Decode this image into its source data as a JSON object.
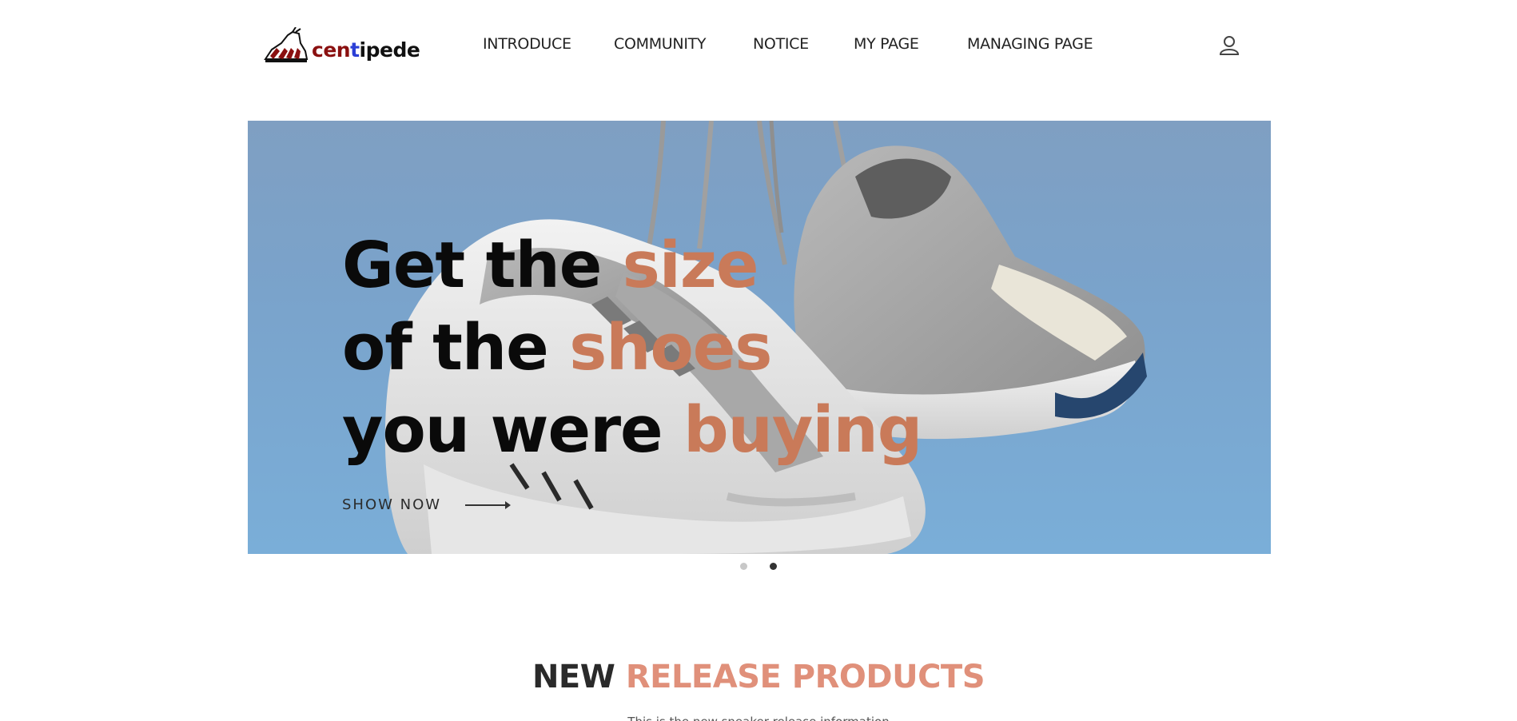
{
  "header": {
    "logo": {
      "text_a": "cen",
      "text_b": "t",
      "text_c": "ipede"
    },
    "nav": [
      {
        "label": "INTRODUCE"
      },
      {
        "label": "COMMUNITY"
      },
      {
        "label": "NOTICE"
      },
      {
        "label": "MY PAGE"
      },
      {
        "label": "MANAGING PAGE"
      }
    ],
    "user_icon": "user-icon"
  },
  "hero": {
    "line1_a": "Get the ",
    "line1_b": "size",
    "line2_a": "of the ",
    "line2_b": "shoes",
    "line3_a": "you were ",
    "line3_b": "buying",
    "cta_label": "SHOW NOW",
    "accent_color": "#c97a59",
    "slides_total": 2,
    "active_slide": 2
  },
  "section": {
    "title_a": "NEW ",
    "title_b": "RELEASE PRODUCTS",
    "subtitle": "This is the new sneaker release information"
  }
}
